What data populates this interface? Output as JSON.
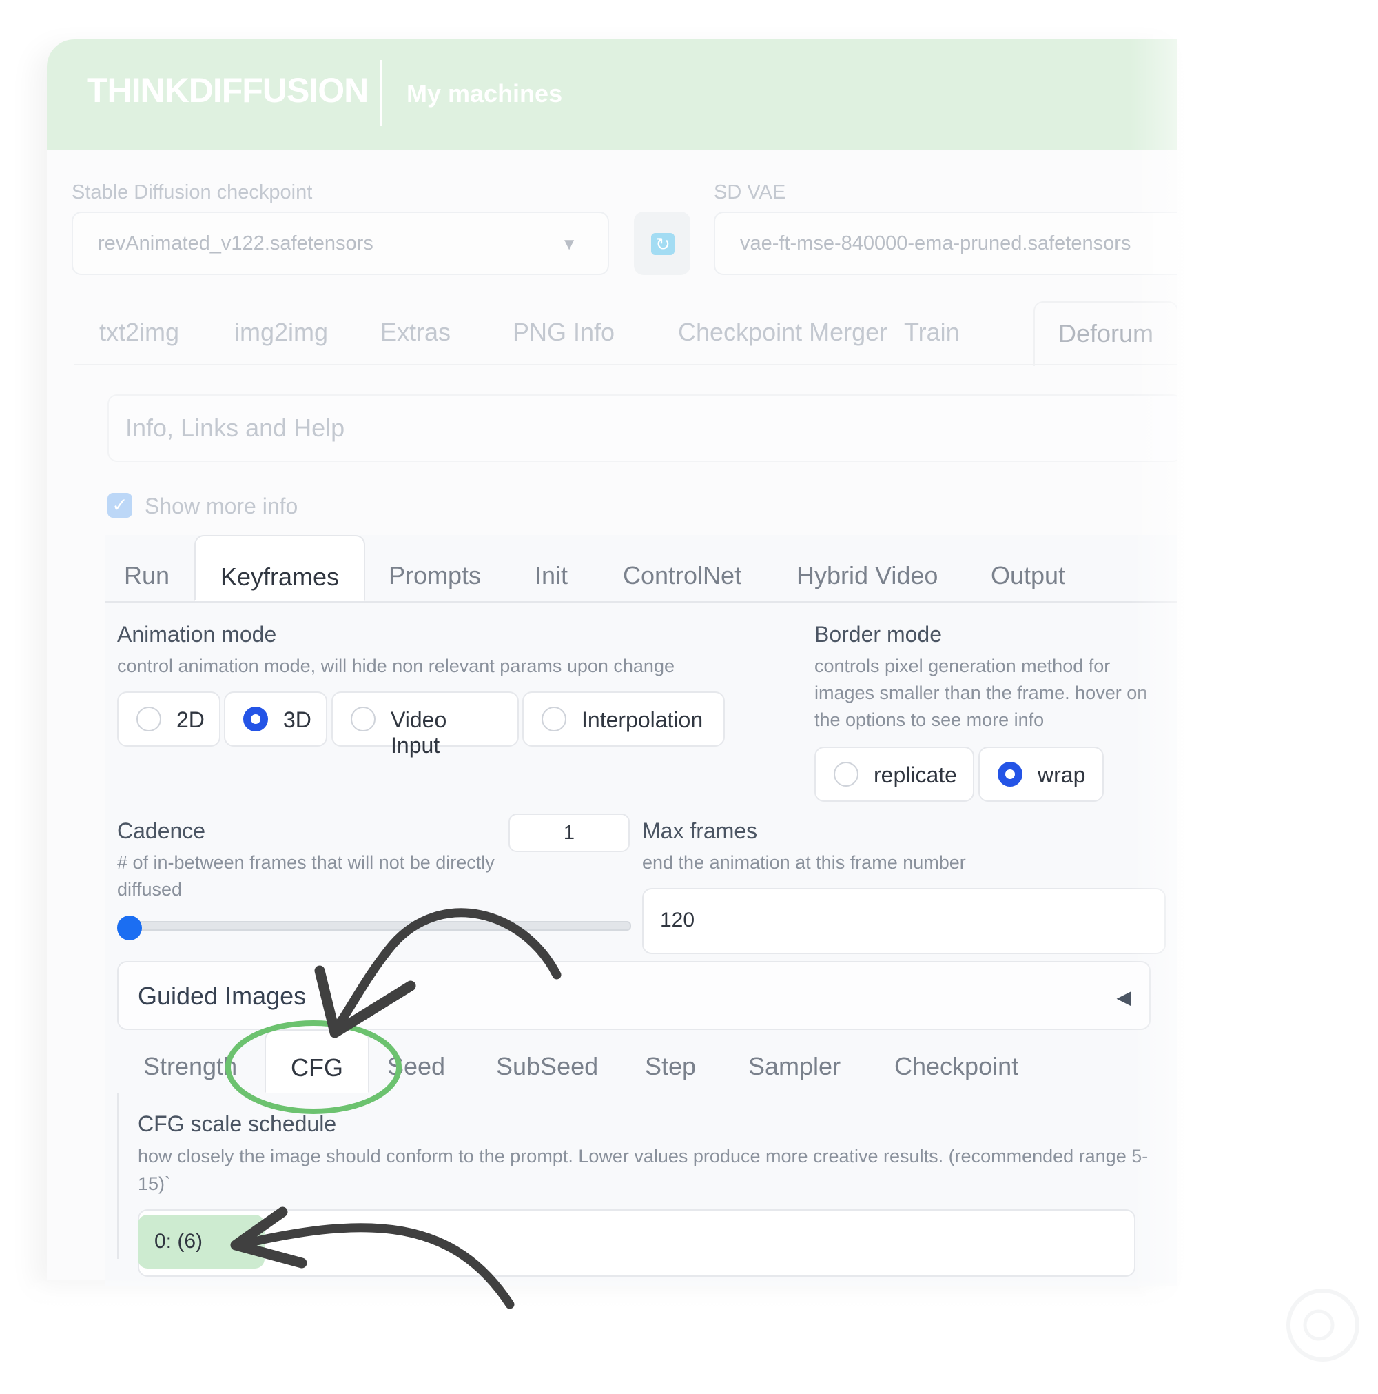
{
  "header": {
    "logo_text": "THINKDIFFUSION",
    "nav_link": "My machines"
  },
  "models": {
    "checkpoint_label": "Stable Diffusion checkpoint",
    "checkpoint_value": "revAnimated_v122.safetensors",
    "vae_label": "SD VAE",
    "vae_value": "vae-ft-mse-840000-ema-pruned.safetensors"
  },
  "top_tabs": [
    "txt2img",
    "img2img",
    "Extras",
    "PNG Info",
    "Checkpoint Merger",
    "Train",
    "Deforum"
  ],
  "top_tabs_active": "Deforum",
  "info_accordion": "Info, Links and Help",
  "show_more_info": {
    "label": "Show more info",
    "checked": true
  },
  "deforum_tabs": [
    "Run",
    "Keyframes",
    "Prompts",
    "Init",
    "ControlNet",
    "Hybrid Video",
    "Output"
  ],
  "deforum_tabs_active": "Keyframes",
  "animation_mode": {
    "title": "Animation mode",
    "desc": "control animation mode, will hide non relevant params upon change",
    "options": [
      "2D",
      "3D",
      "Video Input",
      "Interpolation"
    ],
    "selected": "3D"
  },
  "border_mode": {
    "title": "Border mode",
    "desc_lines": [
      "controls pixel generation method for",
      "images smaller than the frame. hover on",
      "the options to see more info"
    ],
    "options": [
      "replicate",
      "wrap"
    ],
    "selected": "wrap"
  },
  "cadence": {
    "title": "Cadence",
    "desc_lines": [
      "# of in-between frames that will not be directly",
      "diffused"
    ],
    "value": "1",
    "slider_fraction": 0
  },
  "max_frames": {
    "title": "Max frames",
    "desc": "end the animation at this frame number",
    "value": "120"
  },
  "guided_images": {
    "title": "Guided Images"
  },
  "schedule_tabs": [
    "Strength",
    "CFG",
    "Seed",
    "SubSeed",
    "Step",
    "Sampler",
    "Checkpoint"
  ],
  "schedule_tabs_active": "CFG",
  "cfg_schedule": {
    "title": "CFG scale schedule",
    "desc_lines": [
      "how closely the image should conform to the prompt. Lower values produce more creative results. (recommended range 5-",
      "15)`"
    ],
    "value": "0: (6)"
  },
  "colors": {
    "accent_green": "#6cc26f",
    "header_green": "#dff1e0",
    "radio_blue": "#2454e6",
    "arrow": "#404040"
  }
}
